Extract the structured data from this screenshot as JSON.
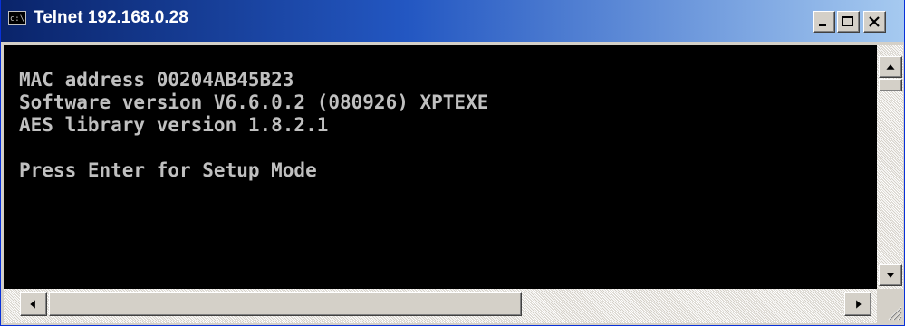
{
  "window": {
    "title": "Telnet 192.168.0.28",
    "icon_text": "c:\\"
  },
  "terminal": {
    "lines": [
      "MAC address 00204AB45B23",
      "Software version V6.6.0.2 (080926) XPTEXE",
      "AES library version 1.8.2.1",
      "",
      "Press Enter for Setup Mode"
    ]
  },
  "icons": {
    "app": "console-icon",
    "minimize": "minimize-icon",
    "maximize": "maximize-icon",
    "close": "close-icon",
    "scroll_up": "arrow-up-icon",
    "scroll_down": "arrow-down-icon",
    "scroll_left": "arrow-left-icon",
    "scroll_right": "arrow-right-icon",
    "size_grip": "resize-grip-icon"
  },
  "colors": {
    "title_gradient_start": "#0a246a",
    "title_gradient_end": "#a6caf0",
    "terminal_bg": "#000000",
    "terminal_fg": "#c0c0c0",
    "chrome": "#d4d0c8"
  }
}
